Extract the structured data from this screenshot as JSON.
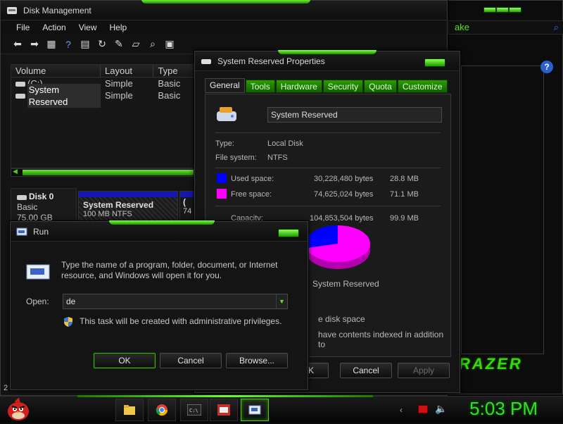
{
  "disk_management": {
    "title": "Disk Management",
    "menu": [
      "File",
      "Action",
      "View",
      "Help"
    ],
    "columns": [
      "Volume",
      "Layout",
      "Type"
    ],
    "rows": [
      {
        "volume": "(C:)",
        "layout": "Simple",
        "type": "Basic"
      },
      {
        "volume": "System Reserved",
        "layout": "Simple",
        "type": "Basic"
      }
    ],
    "disk": {
      "name": "Disk 0",
      "kind": "Basic",
      "size": "75.00 GB"
    },
    "partition": {
      "name": "System Reserved",
      "info": "100 MB NTFS"
    },
    "partition2_stub": "(",
    "partition2_stub_size": "74",
    "status_stub": "2 i"
  },
  "properties": {
    "title": "System Reserved Properties",
    "tabs": [
      "General",
      "Tools",
      "Hardware",
      "Security",
      "Quota",
      "Customize"
    ],
    "name_value": "System Reserved",
    "type_label": "Type:",
    "type_value": "Local Disk",
    "fs_label": "File system:",
    "fs_value": "NTFS",
    "used_label": "Used space:",
    "used_bytes": "30,228,480 bytes",
    "used_mb": "28.8 MB",
    "free_label": "Free space:",
    "free_bytes": "74,625,024 bytes",
    "free_mb": "71.1 MB",
    "capacity_label": "Capacity:",
    "capacity_bytes": "104,853,504 bytes",
    "capacity_mb": "99.9 MB",
    "pie_label": "System Reserved",
    "compress_stub": "e disk space",
    "index_stub": "have contents indexed in addition to",
    "buttons": {
      "ok_stub": "K",
      "cancel": "Cancel",
      "apply": "Apply"
    },
    "colors": {
      "used": "#0000ff",
      "free": "#ff00ff"
    },
    "chart_data": {
      "type": "pie",
      "categories": [
        "Used space",
        "Free space"
      ],
      "values": [
        28.8,
        71.1
      ]
    }
  },
  "run": {
    "title": "Run",
    "description": "Type the name of a program, folder, document, or Internet resource, and Windows will open it for you.",
    "open_label": "Open:",
    "open_value": "de",
    "admin_note": "This task will be created with administrative privileges.",
    "buttons": {
      "ok": "OK",
      "cancel": "Cancel",
      "browse": "Browse..."
    }
  },
  "background": {
    "search_stub": "ake",
    "help": "?",
    "brand": "RAZER"
  },
  "taskbar": {
    "clock": "5:03 PM",
    "items": [
      "explorer-icon",
      "chrome-icon",
      "cmd-icon",
      "taskmgr-icon",
      "run-icon"
    ]
  }
}
